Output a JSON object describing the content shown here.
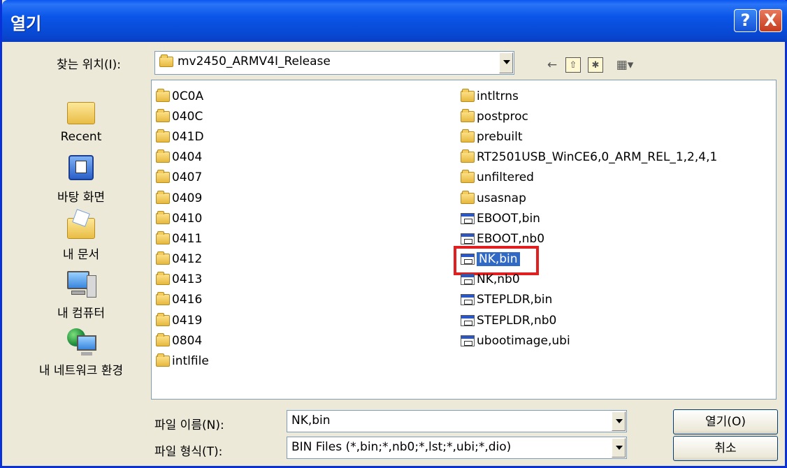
{
  "window": {
    "title": "열기",
    "help_glyph": "?",
    "close_glyph": "X"
  },
  "lookin": {
    "label": "찾는 위치(I):",
    "value": "mv2450_ARMV4I_Release"
  },
  "toolbar": {
    "back_glyph": "←",
    "up_glyph": "⇧",
    "newfolder_glyph": "✱",
    "views_glyph": "▦▾"
  },
  "places": [
    {
      "label": "Recent",
      "icon": "recent-folder-icon"
    },
    {
      "label": "바탕 화면",
      "icon": "desktop-icon"
    },
    {
      "label": "내 문서",
      "icon": "my-documents-icon"
    },
    {
      "label": "내 컴퓨터",
      "icon": "my-computer-icon"
    },
    {
      "label": "내 네트워크 환경",
      "icon": "network-places-icon"
    }
  ],
  "files": {
    "col1": [
      {
        "name": "0C0A",
        "type": "folder"
      },
      {
        "name": "040C",
        "type": "folder"
      },
      {
        "name": "041D",
        "type": "folder"
      },
      {
        "name": "0404",
        "type": "folder"
      },
      {
        "name": "0407",
        "type": "folder"
      },
      {
        "name": "0409",
        "type": "folder"
      },
      {
        "name": "0410",
        "type": "folder"
      },
      {
        "name": "0411",
        "type": "folder"
      },
      {
        "name": "0412",
        "type": "folder"
      },
      {
        "name": "0413",
        "type": "folder"
      },
      {
        "name": "0416",
        "type": "folder"
      },
      {
        "name": "0419",
        "type": "folder"
      },
      {
        "name": "0804",
        "type": "folder"
      },
      {
        "name": "intlfile",
        "type": "folder"
      }
    ],
    "col2": [
      {
        "name": "intltrns",
        "type": "folder"
      },
      {
        "name": "postproc",
        "type": "folder"
      },
      {
        "name": "prebuilt",
        "type": "folder"
      },
      {
        "name": "RT2501USB_WinCE6,0_ARM_REL_1,2,4,1",
        "type": "folder"
      },
      {
        "name": "unfiltered",
        "type": "folder"
      },
      {
        "name": "usasnap",
        "type": "folder"
      },
      {
        "name": "EBOOT,bin",
        "type": "file"
      },
      {
        "name": "EBOOT,nb0",
        "type": "file"
      },
      {
        "name": "NK,bin",
        "type": "file",
        "selected": true
      },
      {
        "name": "NK,nb0",
        "type": "file"
      },
      {
        "name": "STEPLDR,bin",
        "type": "file"
      },
      {
        "name": "STEPLDR,nb0",
        "type": "file"
      },
      {
        "name": "ubootimage,ubi",
        "type": "file"
      }
    ]
  },
  "filename": {
    "label": "파일 이름(N):",
    "value": "NK,bin"
  },
  "filetype": {
    "label": "파일 형식(T):",
    "value": "BIN Files (*,bin;*,nb0;*,lst;*,ubi;*,dio)"
  },
  "buttons": {
    "open": "열기(O)",
    "cancel": "취소"
  }
}
